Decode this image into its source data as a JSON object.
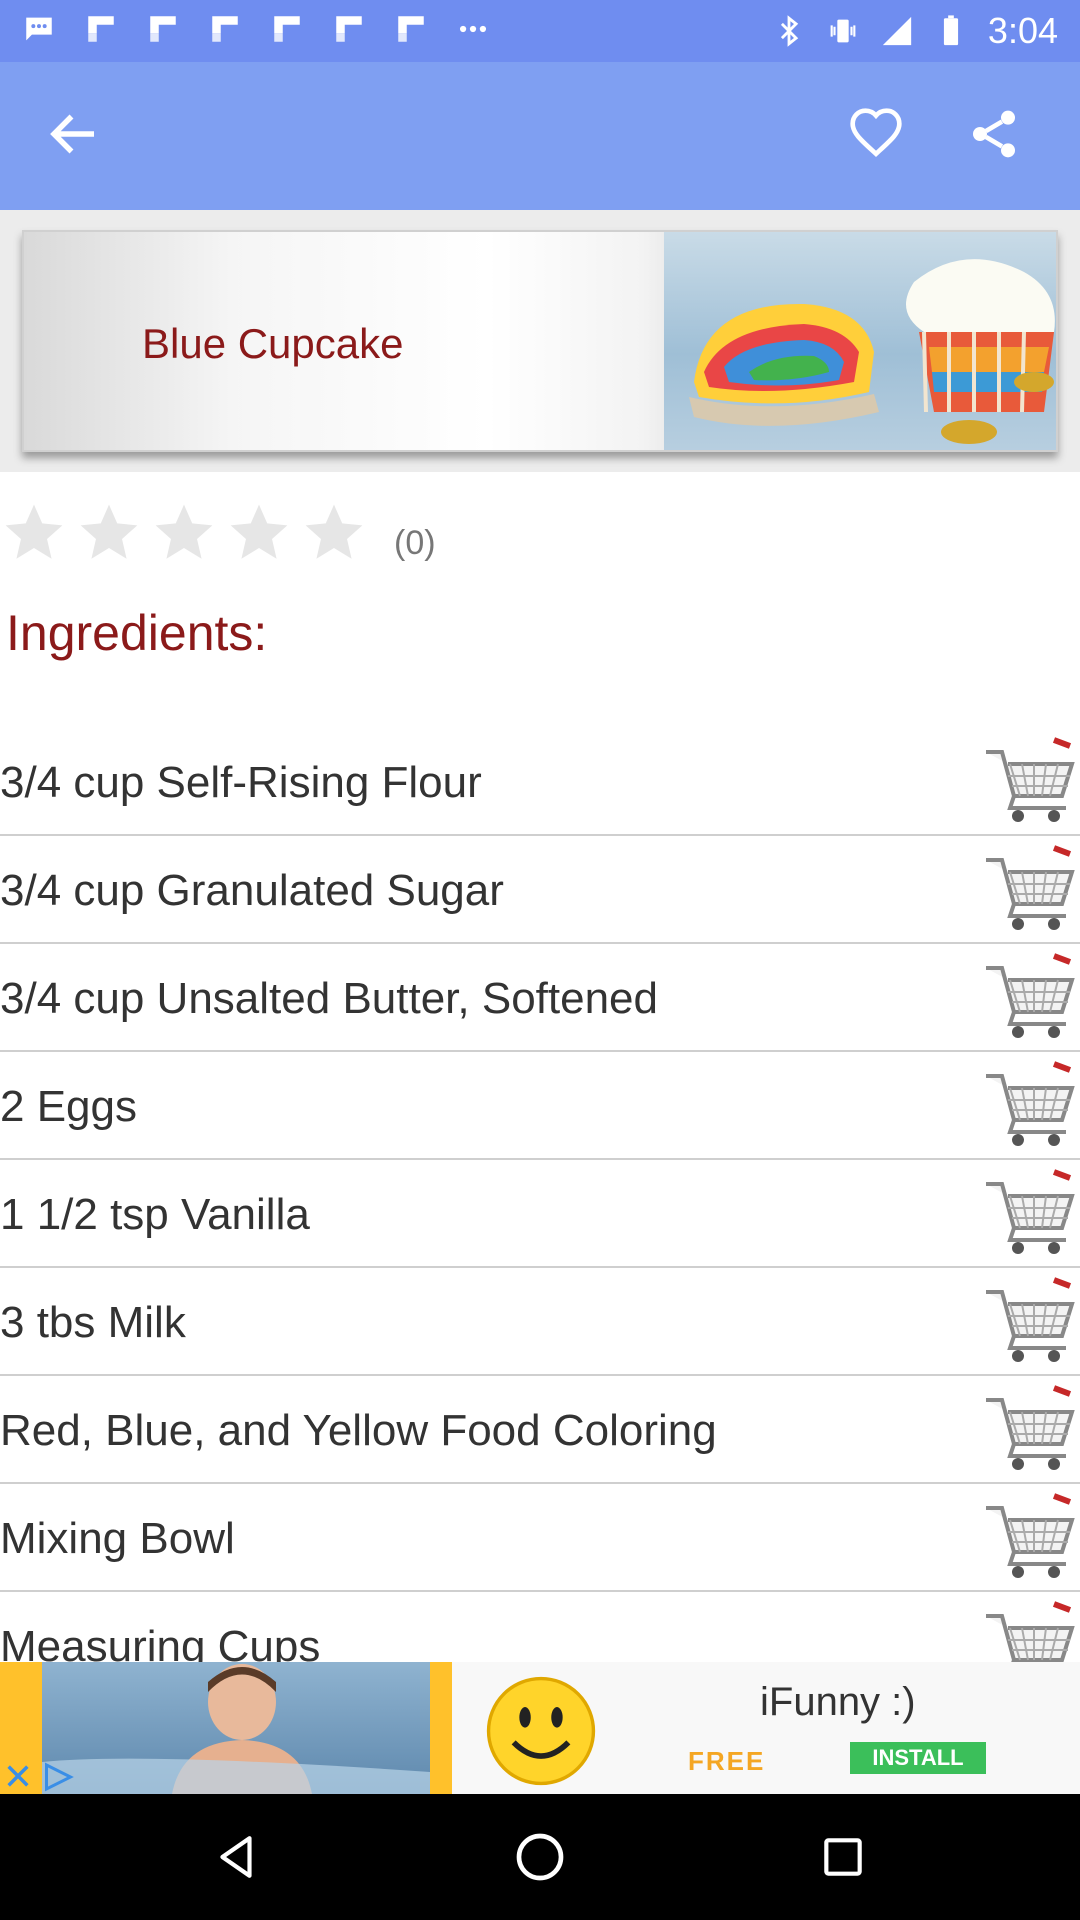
{
  "status_bar": {
    "time": "3:04",
    "icons_left": [
      "chat-icon",
      "flipboard-icon",
      "flipboard-icon",
      "flipboard-icon",
      "flipboard-icon",
      "flipboard-icon",
      "flipboard-icon",
      "more-dots-icon"
    ],
    "icons_right": [
      "bluetooth-icon",
      "vibrate-icon",
      "signal-icon",
      "battery-icon"
    ]
  },
  "app_bar": {
    "back_icon": "arrow-back-icon",
    "favorite_icon": "heart-outline-icon",
    "share_icon": "share-icon"
  },
  "header": {
    "title": "Blue Cupcake"
  },
  "rating": {
    "value": 0,
    "max": 5,
    "count_label": "(0)"
  },
  "ingredients": {
    "heading": "Ingredients:",
    "items": [
      {
        "text": "3/4 cup Self-Rising Flour"
      },
      {
        "text": "3/4 cup Granulated Sugar"
      },
      {
        "text": "3/4 cup Unsalted Butter, Softened"
      },
      {
        "text": "2 Eggs"
      },
      {
        "text": "1 1/2 tsp Vanilla"
      },
      {
        "text": "3 tbs Milk"
      },
      {
        "text": "Red, Blue, and Yellow Food Coloring"
      },
      {
        "text": "Mixing Bowl"
      },
      {
        "text": "Measuring Cups"
      }
    ],
    "cart_icon": "shopping-cart-icon"
  },
  "ad": {
    "app_name": "iFunny :)",
    "free_label": "FREE",
    "install_label": "INSTALL"
  },
  "nav_bar": {
    "back_icon": "nav-back-icon",
    "home_icon": "nav-home-icon",
    "recents_icon": "nav-recents-icon"
  },
  "colors": {
    "status_bar": "#6f8df0",
    "app_bar": "#7f9ff2",
    "accent_text": "#8b1a1a",
    "install_button": "#3bbf5a",
    "ad_background": "#ffc12b"
  }
}
